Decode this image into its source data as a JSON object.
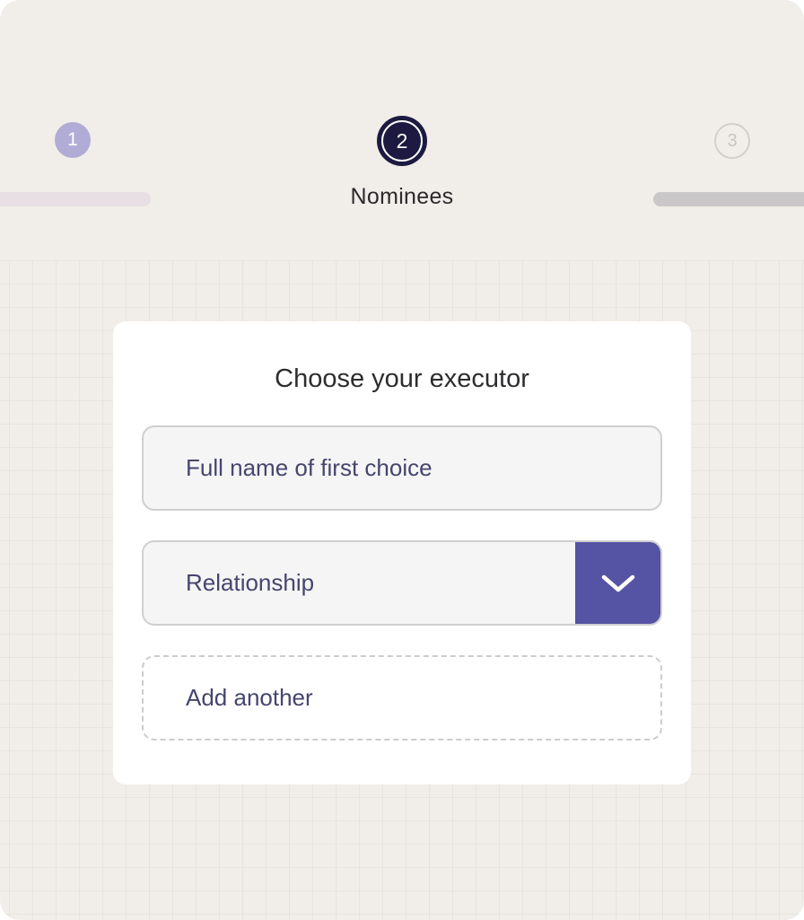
{
  "stepper": {
    "steps": [
      {
        "number": "1",
        "state": "completed"
      },
      {
        "number": "2",
        "state": "current",
        "label": "Nominees"
      },
      {
        "number": "3",
        "state": "upcoming"
      }
    ]
  },
  "card": {
    "title": "Choose your executor",
    "name_field": {
      "placeholder": "Full name of first choice"
    },
    "relationship_select": {
      "placeholder": "Relationship",
      "icon": "chevron-down-icon"
    },
    "add_another_label": "Add another"
  },
  "colors": {
    "background": "#f1ede9",
    "accent": "#5553a3",
    "current_step": "#1c1a40",
    "completed_step": "#b1acd6",
    "field_text": "#46456e"
  }
}
